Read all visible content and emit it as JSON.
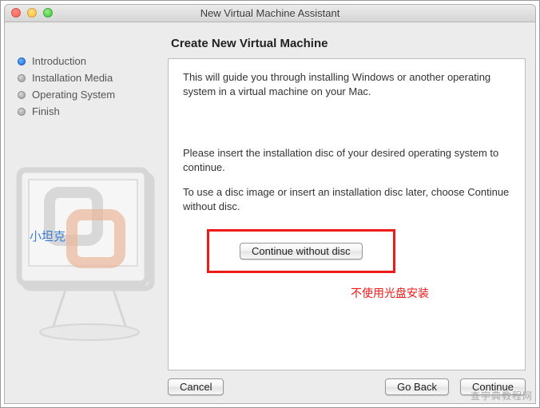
{
  "window": {
    "title": "New Virtual Machine Assistant"
  },
  "sidebar": {
    "steps": [
      {
        "label": "Introduction",
        "active": true
      },
      {
        "label": "Installation Media",
        "active": false
      },
      {
        "label": "Operating System",
        "active": false
      },
      {
        "label": "Finish",
        "active": false
      }
    ]
  },
  "content": {
    "heading": "Create New Virtual Machine",
    "intro": "This will guide you through installing Windows or another operating system in a virtual machine on your Mac.",
    "prompt1": "Please insert the installation disc of your desired operating system to continue.",
    "prompt2": "To use a disc image or insert an installation disc later, choose Continue without disc.",
    "continue_without_disc_label": "Continue without disc",
    "red_note": "不使用光盘安装"
  },
  "footer": {
    "cancel": "Cancel",
    "go_back": "Go Back",
    "continue": "Continue"
  },
  "watermarks": {
    "tank": "小坦克",
    "bottom_right": "查字典教程网"
  }
}
